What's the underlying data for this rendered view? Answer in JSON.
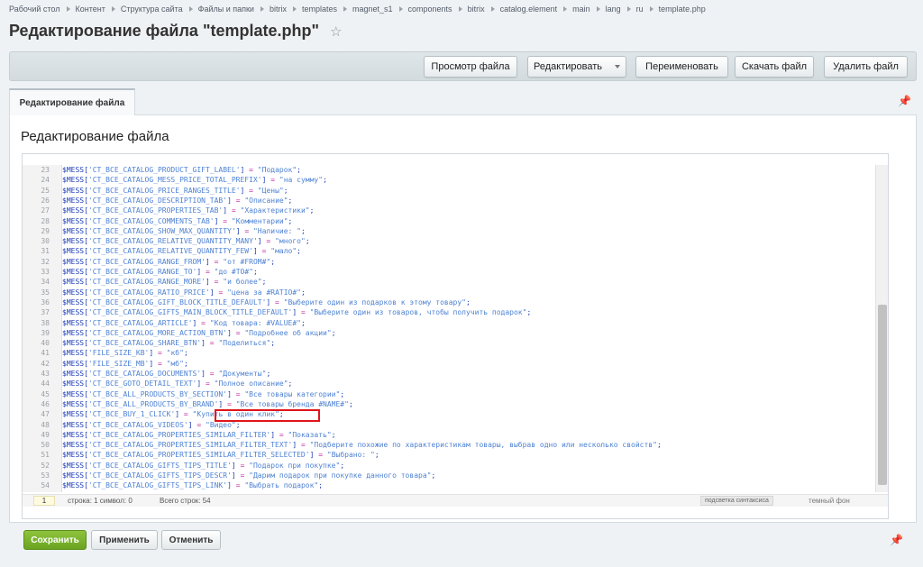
{
  "breadcrumb": [
    "Рабочий стол",
    "Контент",
    "Структура сайта",
    "Файлы и папки",
    "bitrix",
    "templates",
    "magnet_s1",
    "components",
    "bitrix",
    "catalog.element",
    "main",
    "lang",
    "ru",
    "template.php"
  ],
  "page_title": "Редактирование файла \"template.php\"",
  "toolbar": {
    "view": "Просмотр файла",
    "edit": "Редактировать",
    "rename": "Переименовать",
    "download": "Скачать файл",
    "delete": "Удалить файл"
  },
  "tab": {
    "label": "Редактирование файла"
  },
  "section_title": "Редактирование файла",
  "code_lines": [
    {
      "n": "23",
      "key": "CT_BCE_CATALOG_PRODUCT_GIFT_LABEL",
      "val": "Подарок"
    },
    {
      "n": "24",
      "key": "CT_BCE_CATALOG_MESS_PRICE_TOTAL_PREFIX",
      "val": "на сумму"
    },
    {
      "n": "25",
      "key": "CT_BCE_CATALOG_PRICE_RANGES_TITLE",
      "val": "Цены"
    },
    {
      "n": "26",
      "key": "CT_BCE_CATALOG_DESCRIPTION_TAB",
      "val": "Описание"
    },
    {
      "n": "27",
      "key": "CT_BCE_CATALOG_PROPERTIES_TAB",
      "val": "Характеристики"
    },
    {
      "n": "28",
      "key": "CT_BCE_CATALOG_COMMENTS_TAB",
      "val": "Комментарии"
    },
    {
      "n": "29",
      "key": "CT_BCE_CATALOG_SHOW_MAX_QUANTITY",
      "val": "Наличие: "
    },
    {
      "n": "30",
      "key": "CT_BCE_CATALOG_RELATIVE_QUANTITY_MANY",
      "val": "много"
    },
    {
      "n": "31",
      "key": "CT_BCE_CATALOG_RELATIVE_QUANTITY_FEW",
      "val": "мало"
    },
    {
      "n": "32",
      "key": "CT_BCE_CATALOG_RANGE_FROM",
      "val": "от #FROM#"
    },
    {
      "n": "33",
      "key": "CT_BCE_CATALOG_RANGE_TO",
      "val": "до #TO#"
    },
    {
      "n": "34",
      "key": "CT_BCE_CATALOG_RANGE_MORE",
      "val": "и более"
    },
    {
      "n": "35",
      "key": "CT_BCE_CATALOG_RATIO_PRICE",
      "val": "цена за #RATIO#"
    },
    {
      "n": "36",
      "key": "CT_BCE_CATALOG_GIFT_BLOCK_TITLE_DEFAULT",
      "val": "Выберите один из подарков к этому товару"
    },
    {
      "n": "37",
      "key": "CT_BCE_CATALOG_GIFTS_MAIN_BLOCK_TITLE_DEFAULT",
      "val": "Выберите один из товаров, чтобы получить подарок"
    },
    {
      "n": "38",
      "key": "CT_BCE_CATALOG_ARTICLE",
      "val": "Код товара: #VALUE#"
    },
    {
      "n": "39",
      "key": "CT_BCE_CATALOG_MORE_ACTION_BTN",
      "val": "Подробнее об акции"
    },
    {
      "n": "40",
      "key": "CT_BCE_CATALOG_SHARE_BTN",
      "val": "Поделиться"
    },
    {
      "n": "41",
      "key": "FILE_SIZE_KB",
      "val": "кб"
    },
    {
      "n": "42",
      "key": "FILE_SIZE_MB",
      "val": "мб"
    },
    {
      "n": "43",
      "key": "CT_BCE_CATALOG_DOCUMENTS",
      "val": "Документы"
    },
    {
      "n": "44",
      "key": "CT_BCE_GOTO_DETAIL_TEXT",
      "val": "Полное описание"
    },
    {
      "n": "45",
      "key": "CT_BCE_ALL_PRODUCTS_BY_SECTION",
      "val": "Все товары категории"
    },
    {
      "n": "46",
      "key": "CT_BCE_ALL_PRODUCTS_BY_BRAND",
      "val": "Все товары бренда #NAME#"
    },
    {
      "n": "47",
      "key": "CT_BCE_BUY_1_CLICK",
      "val": "Купить в один клик"
    },
    {
      "n": "48",
      "key": "CT_BCE_CATALOG_VIDEOS",
      "val": "Видео"
    },
    {
      "n": "49",
      "key": "CT_BCE_CATALOG_PROPERTIES_SIMILAR_FILTER",
      "val": "Показать"
    },
    {
      "n": "50",
      "key": "CT_BCE_CATALOG_PROPERTIES_SIMILAR_FILTER_TEXT",
      "val": "Подберите похожие по характеристикам товары, выбрав одно или несколько свойств"
    },
    {
      "n": "51",
      "key": "CT_BCE_CATALOG_PROPERTIES_SIMILAR_FILTER_SELECTED",
      "val": "Выбрано: "
    },
    {
      "n": "52",
      "key": "CT_BCE_CATALOG_GIFTS_TIPS_TITLE",
      "val": "Подарок при покупке"
    },
    {
      "n": "53",
      "key": "CT_BCE_CATALOG_GIFTS_TIPS_DESCR",
      "val": "Дарим подарок при покупке данного товара"
    },
    {
      "n": "54",
      "key": "CT_BCE_CATALOG_GIFTS_TIPS_LINK",
      "val": "Выбрать подарок"
    }
  ],
  "status": {
    "current_line": "1",
    "position": "строка: 1  символ: 0",
    "total": "Всего строк: 54",
    "syntax_toggle": "подсветка синтаксиса",
    "dark_toggle": "темный фон"
  },
  "footer": {
    "save": "Сохранить",
    "apply": "Применить",
    "cancel": "Отменить"
  },
  "icons": {
    "favorite": "star-icon",
    "pin": "pin-icon"
  },
  "colors": {
    "highlight_border": "#e0151b",
    "save_button": "#6aa320"
  }
}
